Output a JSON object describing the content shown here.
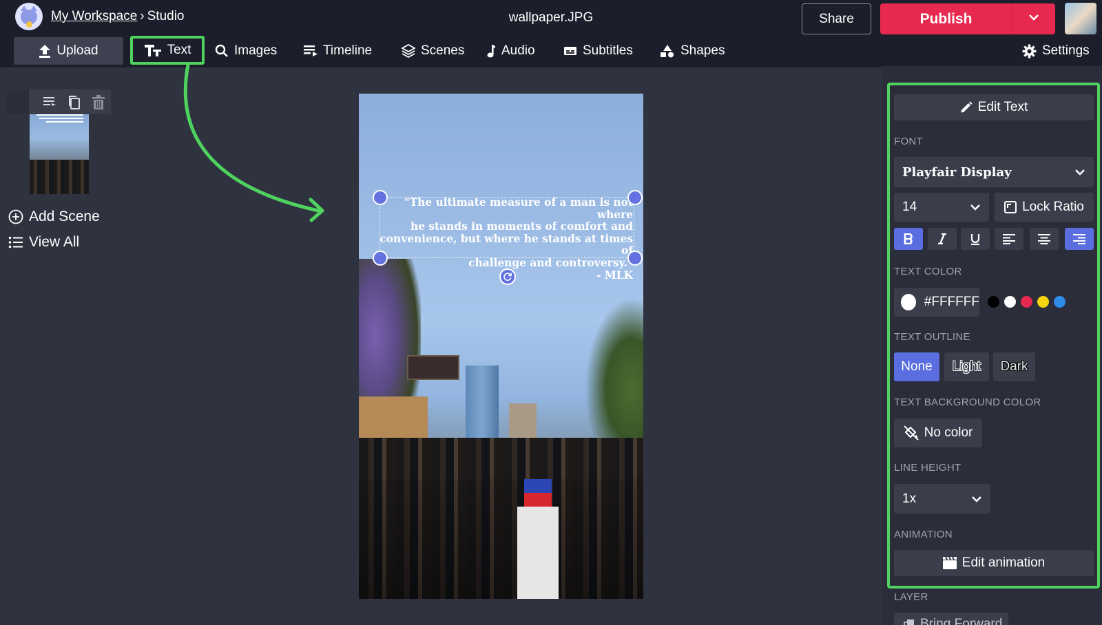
{
  "header": {
    "workspace": "My Workspace",
    "separator": "›",
    "section": "Studio",
    "filename": "wallpaper.JPG",
    "share_label": "Share",
    "publish_label": "Publish"
  },
  "toolbar": {
    "upload": "Upload",
    "text": "Text",
    "images": "Images",
    "timeline": "Timeline",
    "scenes": "Scenes",
    "audio": "Audio",
    "subtitles": "Subtitles",
    "shapes": "Shapes",
    "settings": "Settings"
  },
  "left_panel": {
    "add_scene": "Add Scene",
    "view_all": "View All"
  },
  "canvas": {
    "quote": "\"The ultimate measure of a man is not where\nhe stands in moments of comfort and\nconvenience, but where he stands at times of\nchallenge and controversy.\"\n- MLK"
  },
  "right_panel": {
    "edit_text": "Edit Text",
    "font_label": "FONT",
    "font_value": "Playfair Display",
    "size_value": "14",
    "lock_ratio": "Lock Ratio",
    "text_color_label": "TEXT COLOR",
    "text_color_value": "#FFFFFF",
    "swatches": [
      "#000000",
      "#ffffff",
      "#e8294f",
      "#f5d50f",
      "#2f8be8"
    ],
    "text_outline_label": "TEXT OUTLINE",
    "outline_none": "None",
    "outline_light": "Light",
    "outline_dark": "Dark",
    "text_bg_label": "TEXT BACKGROUND COLOR",
    "no_color": "No color",
    "line_height_label": "LINE HEIGHT",
    "line_height_value": "1x",
    "animation_label": "ANIMATION",
    "edit_animation": "Edit animation",
    "layer_label": "LAYER",
    "bring_forward": "Bring Forward"
  },
  "colors": {
    "accent_publish": "#e8294f",
    "highlight_green": "#4fd35e",
    "active_blue": "#5b6ee0"
  }
}
